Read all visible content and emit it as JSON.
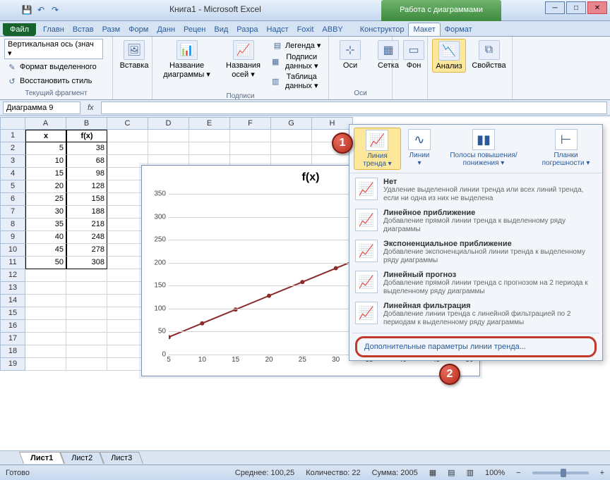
{
  "title": {
    "doc": "Книга1 - Microsoft Excel",
    "tools": "Работа с диаграммами"
  },
  "qat": {
    "save": "💾",
    "undo": "↶",
    "redo": "↷"
  },
  "tabs": {
    "file": "Файл",
    "items": [
      "Главн",
      "Встав",
      "Разм",
      "Форм",
      "Данн",
      "Рецен",
      "Вид",
      "Разра",
      "Надст",
      "Foxit",
      "ABBY"
    ],
    "chart": [
      "Конструктор",
      "Макет",
      "Формат"
    ],
    "active": "Макет"
  },
  "ribbon": {
    "sel": {
      "dd": "Вертикальная ось (знач ▾",
      "fmt": "Формат выделенного",
      "reset": "Восстановить стиль",
      "label": "Текущий фрагмент"
    },
    "ins": {
      "btn": "Вставка",
      "label": ""
    },
    "labels": {
      "ctitle": "Название диаграммы ▾",
      "atitle": "Названия осей ▾",
      "legend": "Легенда ▾",
      "dlabels": "Подписи данных ▾",
      "dtable": "Таблица данных ▾",
      "label": "Подписи"
    },
    "axes": {
      "axes": "Оси",
      "grid": "Сетка",
      "label": "Оси"
    },
    "bg": {
      "bg": "Фон",
      "label": ""
    },
    "analysis": {
      "btn": "Анализ",
      "props": "Свойства",
      "label": ""
    }
  },
  "namebox": "Диаграмма 9",
  "fx": "fx",
  "cols": [
    "A",
    "B",
    "C",
    "D",
    "E",
    "F",
    "G",
    "H"
  ],
  "headers": {
    "x": "x",
    "fx": "f(x)"
  },
  "data": [
    [
      5,
      38
    ],
    [
      10,
      68
    ],
    [
      15,
      98
    ],
    [
      20,
      128
    ],
    [
      25,
      158
    ],
    [
      30,
      188
    ],
    [
      35,
      218
    ],
    [
      40,
      248
    ],
    [
      45,
      278
    ],
    [
      50,
      308
    ]
  ],
  "chart_data": {
    "type": "line",
    "title": "f(x)",
    "x": [
      5,
      10,
      15,
      20,
      25,
      30,
      35,
      40,
      45,
      50
    ],
    "y": [
      38,
      68,
      98,
      128,
      158,
      188,
      218,
      248,
      278,
      308
    ],
    "xticks": [
      5,
      10,
      15,
      20,
      25,
      30,
      35,
      40,
      45,
      50
    ],
    "yticks": [
      0,
      50,
      100,
      150,
      200,
      250,
      300,
      350
    ],
    "ylim": [
      0,
      350
    ]
  },
  "dropdown": {
    "toprow": [
      {
        "l": "Линия тренда ▾"
      },
      {
        "l": "Линии ▾"
      },
      {
        "l": "Полосы повышения/понижения ▾"
      },
      {
        "l": "Планки погрешности ▾"
      }
    ],
    "items": [
      {
        "t": "Нет",
        "d": "Удаление выделенной линии тренда или всех линий тренда, если ни одна из них не выделена"
      },
      {
        "t": "Линейное приближение",
        "d": "Добавление прямой линии тренда к выделенному ряду диаграммы"
      },
      {
        "t": "Экспоненциальное приближение",
        "d": "Добавление экспоненциальной линии тренда к выделенному ряду диаграммы"
      },
      {
        "t": "Линейный прогноз",
        "d": "Добавление прямой линии тренда с прогнозом на 2 периода к выделенному ряду диаграммы"
      },
      {
        "t": "Линейная фильтрация",
        "d": "Добавление линии тренда с линейной фильтрацией по 2 периодам к выделенному ряду диаграммы"
      }
    ],
    "extra": "Дополнительные параметры линии тренда..."
  },
  "sheets": [
    "Лист1",
    "Лист2",
    "Лист3"
  ],
  "status": {
    "ready": "Готово",
    "avg": "Среднее: 100,25",
    "cnt": "Количество: 22",
    "sum": "Сумма: 2005",
    "zoom": "100%"
  }
}
